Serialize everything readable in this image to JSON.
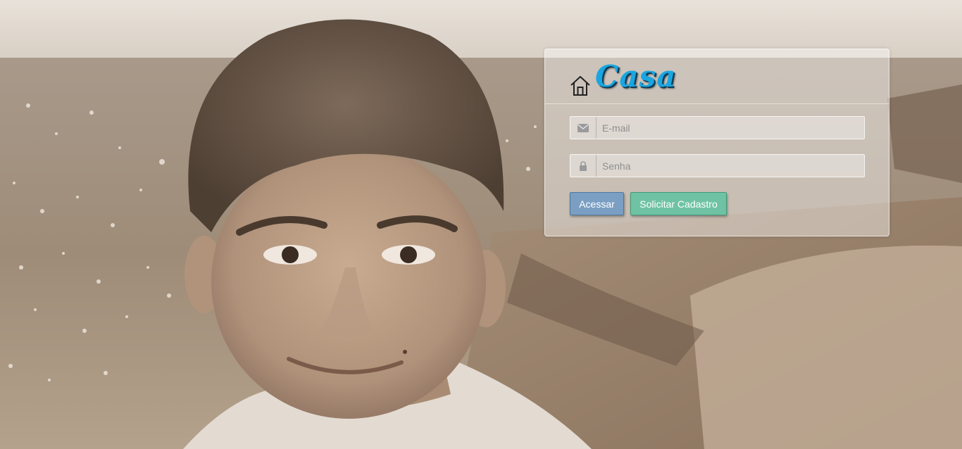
{
  "brand": {
    "title": "Casa",
    "icon": "home-icon",
    "color": "#1aa6e0"
  },
  "login": {
    "email_placeholder": "E-mail",
    "email_value": "",
    "email_icon": "envelope-icon",
    "password_placeholder": "Senha",
    "password_value": "",
    "password_icon": "lock-icon",
    "submit_label": "Acessar",
    "register_label": "Solicitar Cadastro"
  },
  "colors": {
    "submit_button": "#7a9fc3",
    "register_button": "#6fc3a4"
  }
}
